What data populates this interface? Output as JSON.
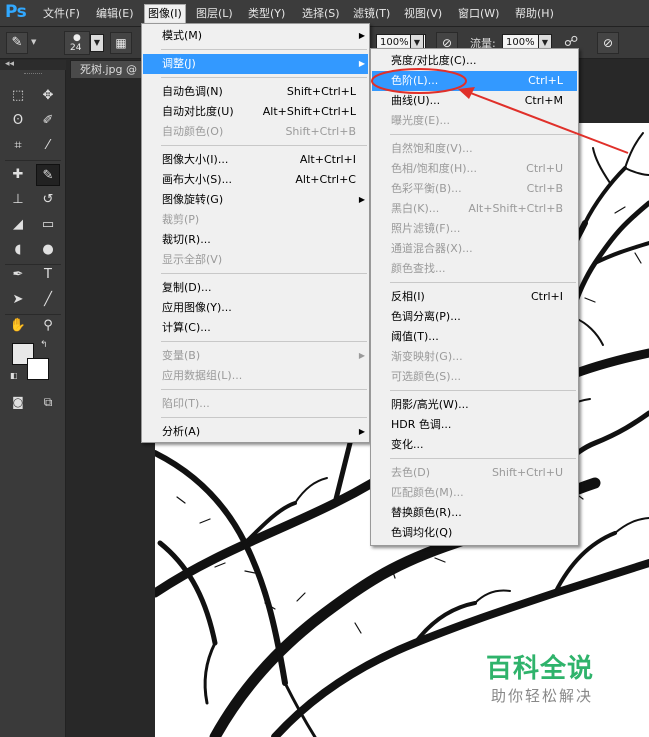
{
  "app": {
    "logo": "Ps"
  },
  "menubar": {
    "items": [
      {
        "label": "文件(F)"
      },
      {
        "label": "编辑(E)"
      },
      {
        "label": "图像(I)"
      },
      {
        "label": "图层(L)"
      },
      {
        "label": "类型(Y)"
      },
      {
        "label": "选择(S)"
      },
      {
        "label": "滤镜(T)"
      },
      {
        "label": "视图(V)"
      },
      {
        "label": "窗口(W)"
      },
      {
        "label": "帮助(H)"
      }
    ]
  },
  "options_bar": {
    "brush_size": "24",
    "opacity_value": "100%",
    "flow_label": "流量:",
    "flow_value": "100%"
  },
  "tool_panel": {
    "collapse_glyph": "◂◂"
  },
  "document": {
    "tab_title": "死树.jpg @"
  },
  "image_menu": {
    "items": [
      {
        "label": "模式(M)",
        "shortcut": "",
        "disabled": false,
        "submenu": true
      },
      {
        "label": "调整(J)",
        "shortcut": "",
        "disabled": false,
        "submenu": true
      },
      {
        "label": "自动色调(N)",
        "shortcut": "Shift+Ctrl+L",
        "disabled": false
      },
      {
        "label": "自动对比度(U)",
        "shortcut": "Alt+Shift+Ctrl+L",
        "disabled": false
      },
      {
        "label": "自动颜色(O)",
        "shortcut": "Shift+Ctrl+B",
        "disabled": true
      },
      {
        "label": "图像大小(I)...",
        "shortcut": "Alt+Ctrl+I",
        "disabled": false
      },
      {
        "label": "画布大小(S)...",
        "shortcut": "Alt+Ctrl+C",
        "disabled": false
      },
      {
        "label": "图像旋转(G)",
        "shortcut": "",
        "disabled": false,
        "submenu": true
      },
      {
        "label": "裁剪(P)",
        "shortcut": "",
        "disabled": true
      },
      {
        "label": "裁切(R)...",
        "shortcut": "",
        "disabled": false
      },
      {
        "label": "显示全部(V)",
        "shortcut": "",
        "disabled": true
      },
      {
        "label": "复制(D)...",
        "shortcut": "",
        "disabled": false
      },
      {
        "label": "应用图像(Y)...",
        "shortcut": "",
        "disabled": false
      },
      {
        "label": "计算(C)...",
        "shortcut": "",
        "disabled": false
      },
      {
        "label": "变量(B)",
        "shortcut": "",
        "disabled": true,
        "submenu": true
      },
      {
        "label": "应用数据组(L)...",
        "shortcut": "",
        "disabled": true
      },
      {
        "label": "陷印(T)...",
        "shortcut": "",
        "disabled": true
      },
      {
        "label": "分析(A)",
        "shortcut": "",
        "disabled": false,
        "submenu": true
      }
    ]
  },
  "adjust_menu": {
    "items": [
      {
        "label": "亮度/对比度(C)...",
        "shortcut": "",
        "disabled": false
      },
      {
        "label": "色阶(L)...",
        "shortcut": "Ctrl+L",
        "disabled": false
      },
      {
        "label": "曲线(U)...",
        "shortcut": "Ctrl+M",
        "disabled": false
      },
      {
        "label": "曝光度(E)...",
        "shortcut": "",
        "disabled": true
      },
      {
        "label": "自然饱和度(V)...",
        "shortcut": "",
        "disabled": true
      },
      {
        "label": "色相/饱和度(H)...",
        "shortcut": "Ctrl+U",
        "disabled": true
      },
      {
        "label": "色彩平衡(B)...",
        "shortcut": "Ctrl+B",
        "disabled": true
      },
      {
        "label": "黑白(K)...",
        "shortcut": "Alt+Shift+Ctrl+B",
        "disabled": true
      },
      {
        "label": "照片滤镜(F)...",
        "shortcut": "",
        "disabled": true
      },
      {
        "label": "通道混合器(X)...",
        "shortcut": "",
        "disabled": true
      },
      {
        "label": "颜色查找...",
        "shortcut": "",
        "disabled": true
      },
      {
        "label": "反相(I)",
        "shortcut": "Ctrl+I",
        "disabled": false
      },
      {
        "label": "色调分离(P)...",
        "shortcut": "",
        "disabled": false
      },
      {
        "label": "阈值(T)...",
        "shortcut": "",
        "disabled": false
      },
      {
        "label": "渐变映射(G)...",
        "shortcut": "",
        "disabled": true
      },
      {
        "label": "可选颜色(S)...",
        "shortcut": "",
        "disabled": true
      },
      {
        "label": "阴影/高光(W)...",
        "shortcut": "",
        "disabled": false
      },
      {
        "label": "HDR 色调...",
        "shortcut": "",
        "disabled": false
      },
      {
        "label": "变化...",
        "shortcut": "",
        "disabled": false
      },
      {
        "label": "去色(D)",
        "shortcut": "Shift+Ctrl+U",
        "disabled": true
      },
      {
        "label": "匹配颜色(M)...",
        "shortcut": "",
        "disabled": true
      },
      {
        "label": "替换颜色(R)...",
        "shortcut": "",
        "disabled": false
      },
      {
        "label": "色调均化(Q)",
        "shortcut": "",
        "disabled": false
      }
    ]
  },
  "annotation": {
    "color": "#e0302a"
  },
  "watermark": {
    "title": "百科全说",
    "subtitle": "助你轻松解决"
  },
  "colors": {
    "menu_highlight": "#3399ff",
    "ps_logo": "#31a8ff",
    "watermark_green": "#2fb36b"
  }
}
